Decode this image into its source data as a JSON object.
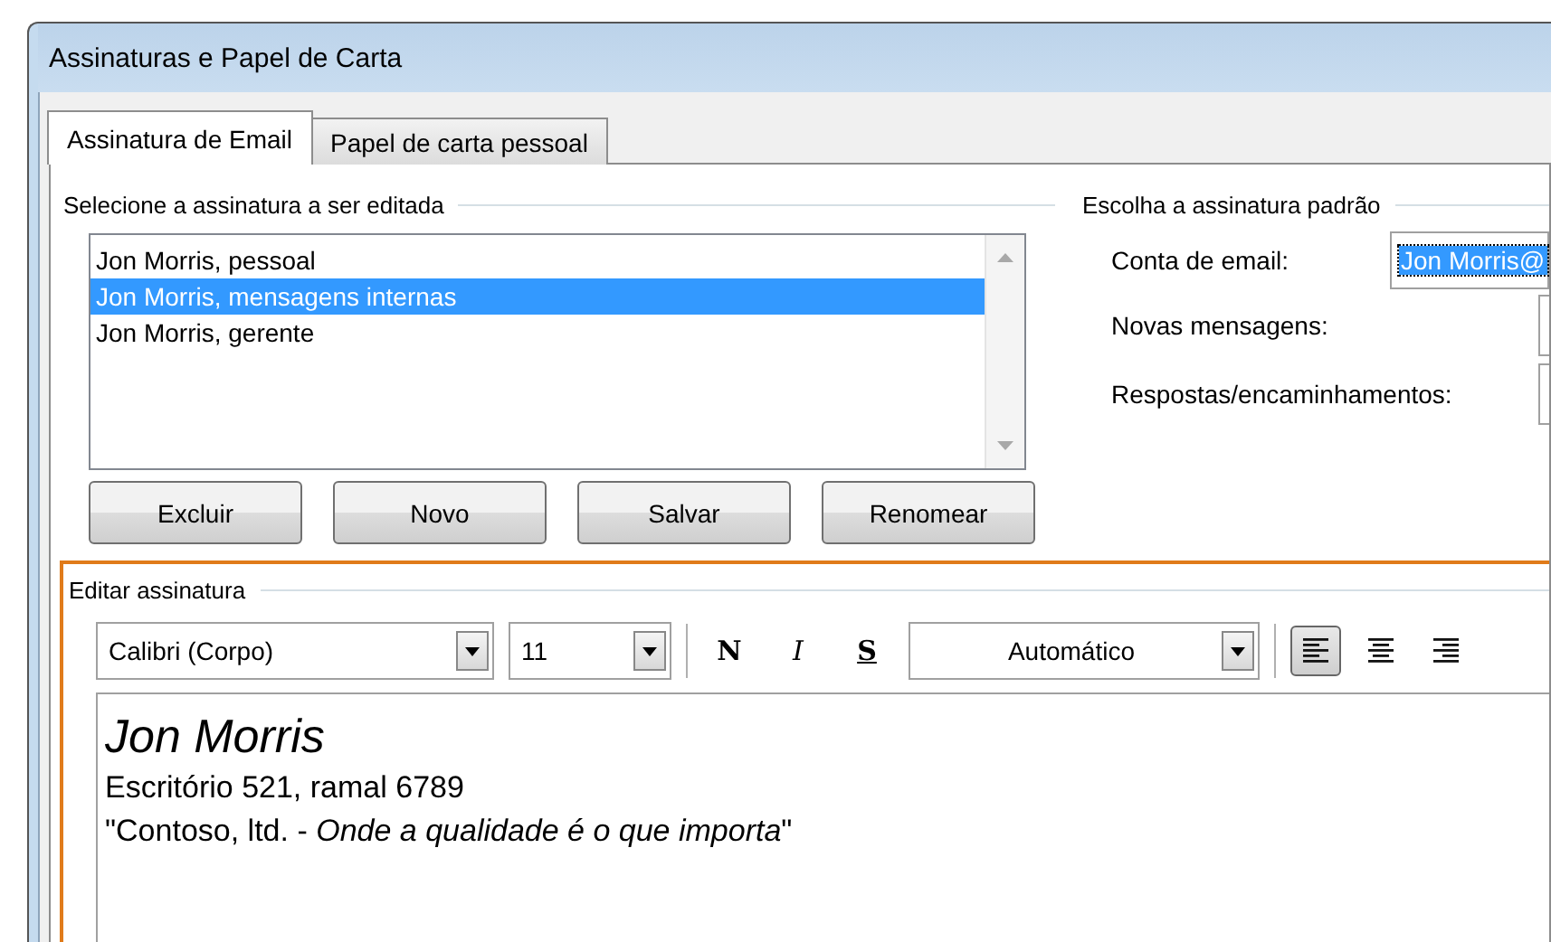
{
  "window": {
    "title": "Assinaturas e Papel de Carta"
  },
  "tabs": [
    {
      "label": "Assinatura de Email",
      "selected": true
    },
    {
      "label": "Papel de carta pessoal",
      "selected": false
    }
  ],
  "signature_list": {
    "heading": "Selecione a assinatura a ser editada",
    "items": [
      {
        "label": "Jon Morris, pessoal",
        "selected": false
      },
      {
        "label": "Jon Morris, mensagens internas",
        "selected": true
      },
      {
        "label": "Jon Morris, gerente",
        "selected": false
      }
    ]
  },
  "buttons": [
    "Excluir",
    "Novo",
    "Salvar",
    "Renomear"
  ],
  "default_signature": {
    "heading": "Escolha a assinatura padrão",
    "fields": [
      {
        "label": "Conta de email:",
        "value": "Jon Morris@"
      },
      {
        "label": "Novas mensagens:"
      },
      {
        "label": "Respostas/encaminhamentos:"
      }
    ]
  },
  "editor": {
    "heading": "Editar assinatura",
    "font": "Calibri (Corpo)",
    "size": "11",
    "format_buttons": [
      {
        "kind": "bold",
        "label": "N"
      },
      {
        "kind": "italic",
        "label": "I"
      },
      {
        "kind": "underline",
        "label": "S"
      }
    ],
    "text_color": "Automático",
    "alignment": [
      {
        "kind": "left",
        "selected": true
      },
      {
        "kind": "center",
        "selected": false
      },
      {
        "kind": "right",
        "selected": false
      }
    ],
    "lines": [
      {
        "kind": "name",
        "text": "Jon Morris"
      },
      {
        "kind": "body",
        "text": "Escritório 521, ramal 6789"
      },
      {
        "kind": "body",
        "text": "\"Contoso, ltd. - *Onde a qualidade é o que importa*\""
      }
    ]
  }
}
